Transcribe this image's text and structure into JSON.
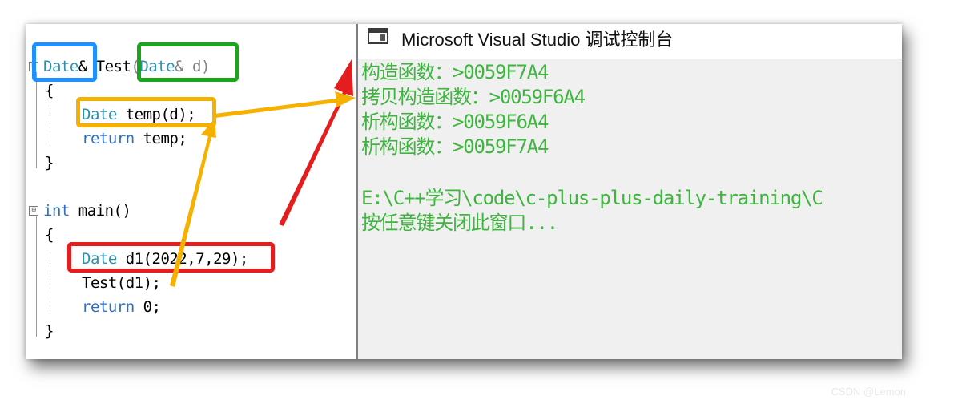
{
  "editor": {
    "lines": [
      {
        "fn_sig": {
          "type": "Date",
          "amp_name": "& Test",
          "paren_open": "(",
          "param_type": "Date",
          "param_rest": "& d",
          "paren_close": ")"
        }
      },
      {
        "text": "{"
      },
      {
        "decl": {
          "type": "Date",
          "rest": " temp(d);"
        }
      },
      {
        "ret": {
          "kw": "return",
          "rest": " temp;"
        }
      },
      {
        "text": "}"
      },
      {
        "main_sig": {
          "kw": "int",
          "rest": " main()"
        }
      },
      {
        "text": "{"
      },
      {
        "decl2": {
          "type": "Date",
          "rest": " d1(2022,7,29);"
        }
      },
      {
        "call": "Test(d1);"
      },
      {
        "ret2": {
          "kw": "return",
          "rest": " 0;"
        }
      },
      {
        "text": "}"
      }
    ]
  },
  "console": {
    "title": "Microsoft Visual Studio 调试控制台",
    "output": [
      "构造函数：>0059F7A4",
      "拷贝构造函数：>0059F6A4",
      "析构函数：>0059F6A4",
      "析构函数：>0059F7A4",
      "",
      "E:\\C++学习\\code\\c-plus-plus-daily-training\\C",
      "按任意键关闭此窗口..."
    ]
  },
  "icons": {
    "window": "console-window-icon",
    "fold1": "collapse-icon",
    "fold2": "collapse-icon"
  },
  "colors": {
    "highlight_blue": "#1e90ff",
    "highlight_green": "#1aa51a",
    "highlight_orange": "#f5b000",
    "highlight_red": "#e41e1e",
    "console_text": "#3fb43f"
  },
  "watermark": "CSDN @Lemon"
}
